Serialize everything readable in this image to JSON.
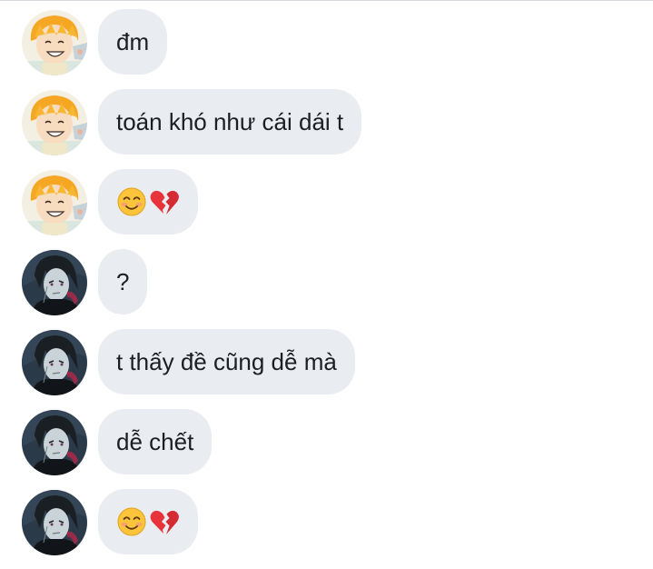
{
  "conversation": {
    "messages": [
      {
        "sender": "zenitsu",
        "avatar_icon": "zenitsu-avatar-icon",
        "text": "đm"
      },
      {
        "sender": "zenitsu",
        "avatar_icon": "zenitsu-avatar-icon",
        "text": "toán khó như cái dái t"
      },
      {
        "sender": "zenitsu",
        "avatar_icon": "zenitsu-avatar-icon",
        "text": "",
        "emojis": [
          "smiling-face-icon",
          "broken-heart-icon"
        ]
      },
      {
        "sender": "genya",
        "avatar_icon": "genya-avatar-icon",
        "text": "?"
      },
      {
        "sender": "genya",
        "avatar_icon": "genya-avatar-icon",
        "text": "t thấy đề cũng dễ mà"
      },
      {
        "sender": "genya",
        "avatar_icon": "genya-avatar-icon",
        "text": "dễ chết"
      },
      {
        "sender": "genya",
        "avatar_icon": "genya-avatar-icon",
        "text": "",
        "emojis": [
          "smiling-face-icon",
          "broken-heart-icon"
        ]
      }
    ]
  },
  "colors": {
    "bubble_background": "#e9ecf0",
    "text": "#1c1e21",
    "divider": "#d6d9de"
  }
}
